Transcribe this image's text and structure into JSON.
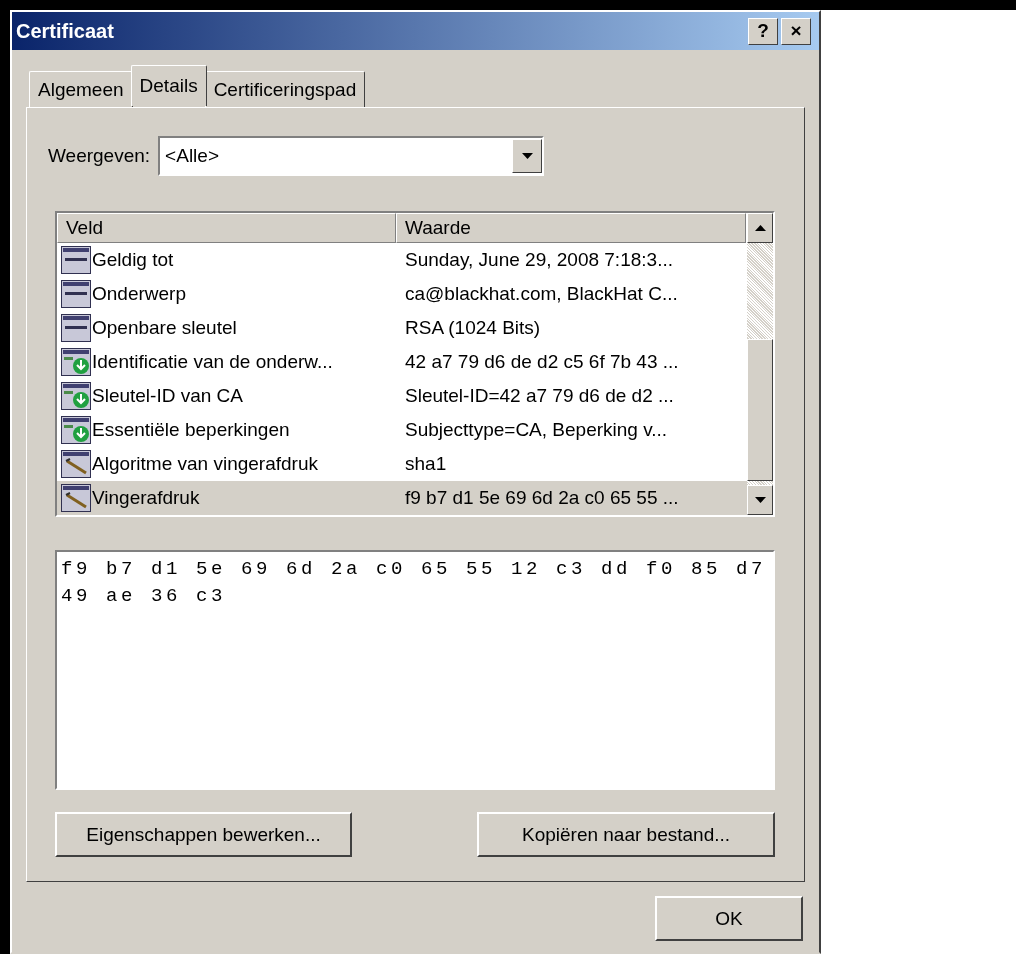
{
  "window": {
    "title": "Certificaat",
    "help_button": "?",
    "close_button": "×"
  },
  "tabs": [
    {
      "label": "Algemeen",
      "selected": false
    },
    {
      "label": "Details",
      "selected": true
    },
    {
      "label": "Certificeringspad",
      "selected": false
    }
  ],
  "show": {
    "label": "Weergeven:",
    "value": "<Alle>"
  },
  "table": {
    "columns": [
      "Veld",
      "Waarde"
    ],
    "rows": [
      {
        "kind": "field",
        "field": "Geldig tot",
        "value": "Sunday, June 29, 2008 7:18:3...",
        "selected": false
      },
      {
        "kind": "field",
        "field": "Onderwerp",
        "value": "ca@blackhat.com, BlackHat C...",
        "selected": false
      },
      {
        "kind": "field",
        "field": "Openbare sleutel",
        "value": "RSA (1024 Bits)",
        "selected": false
      },
      {
        "kind": "extension",
        "field": "Identificatie van de onderw...",
        "value": "42 a7 79 d6 de d2 c5 6f 7b 43 ...",
        "selected": false
      },
      {
        "kind": "extension",
        "field": "Sleutel-ID van CA",
        "value": "Sleutel-ID=42 a7 79 d6 de d2 ...",
        "selected": false
      },
      {
        "kind": "extension",
        "field": "Essentiële beperkingen",
        "value": "Subjecttype=CA, Beperking v...",
        "selected": false
      },
      {
        "kind": "property",
        "field": "Algoritme van vingerafdruk",
        "value": "sha1",
        "selected": false
      },
      {
        "kind": "property",
        "field": "Vingerafdruk",
        "value": "f9 b7 d1 5e 69 6d 2a c0 65 55 ...",
        "selected": true
      }
    ]
  },
  "detail_value": "f9 b7 d1 5e 69 6d 2a c0 65 55 12 c3 dd f0 85 d7 49 ae 36 c3",
  "buttons": [
    "Eigenschappen bewerken...",
    "Kopiëren naar bestand..."
  ],
  "ok_button": "OK"
}
